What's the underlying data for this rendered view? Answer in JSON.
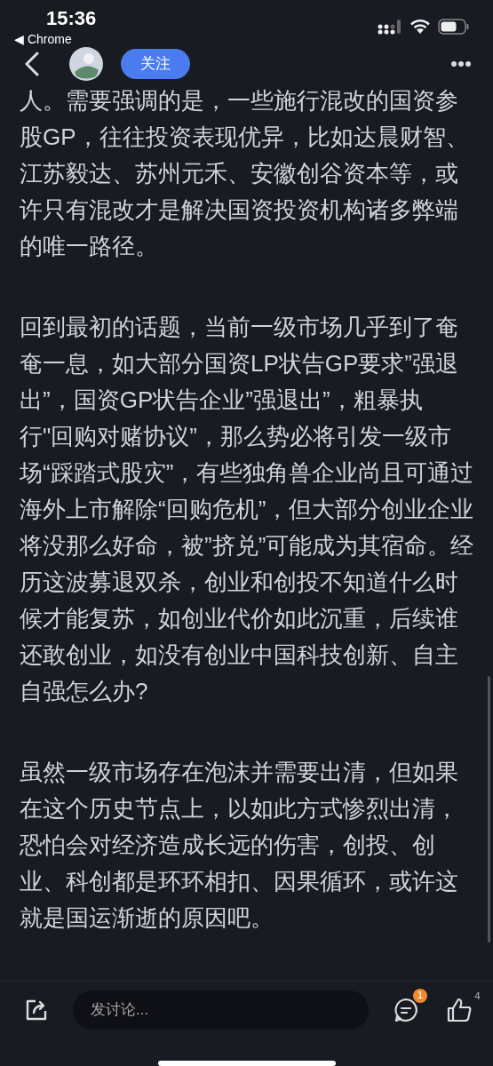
{
  "status_bar": {
    "time": "15:36",
    "back_app": "◀ Chrome"
  },
  "header": {
    "follow_button": "关注"
  },
  "article": {
    "paragraphs": [
      "人。需要强调的是，一些施行混改的国资参股GP，往往投资表现优异，比如达晨财智、江苏毅达、苏州元禾、安徽创谷资本等，或许只有混改才是解决国资投资机构诸多弊端的唯一路径。",
      "回到最初的话题，当前一级市场几乎到了奄奄一息，如大部分国资LP状告GP要求”强退出”，国资GP状告企业”强退出”，粗暴执行\"回购对赌协议”，那么势必将引发一级市场“踩踏式股灾”，有些独角兽企业尚且可通过海外上市解除“回购危机”，但大部分创业企业将没那么好命，被”挤兑”可能成为其宿命。经历这波募退双杀，创业和创投不知道什么时候才能复苏，如创业代价如此沉重，后续谁还敢创业，如没有创业中国科技创新、自主自强怎么办?",
      "虽然一级市场存在泡沫并需要出清，但如果在这个历史节点上，以如此方式惨烈出清，恐怕会对经济造成长远的伤害，创投、创业、科创都是环环相扣、因果循环，或许这就是国运渐逝的原因吧。"
    ]
  },
  "bottom_bar": {
    "comment_placeholder": "发讨论...",
    "comment_badge": "1",
    "like_count": "4"
  }
}
